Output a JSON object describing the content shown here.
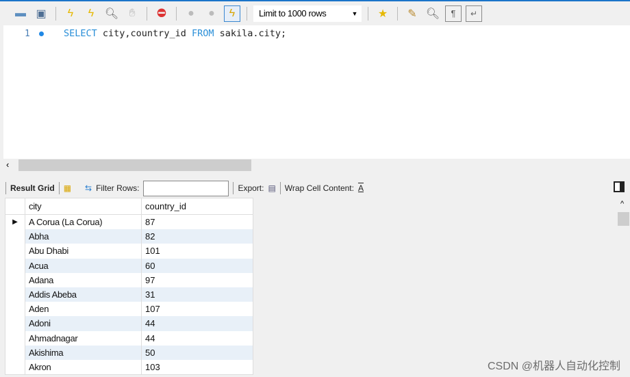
{
  "toolbar": {
    "limit_label": "Limit to 1000 rows"
  },
  "editor": {
    "line_number": "1",
    "keyword_select": "SELECT",
    "columns": " city,country_id ",
    "keyword_from": "FROM",
    "table": " sakila.city;"
  },
  "result_bar": {
    "result_grid": "Result Grid",
    "filter_rows": "Filter Rows:",
    "filter_value": "",
    "export": "Export:",
    "wrap": "Wrap Cell Content:"
  },
  "grid": {
    "columns": [
      "city",
      "country_id"
    ],
    "rows": [
      [
        "A Corua (La Corua)",
        "87"
      ],
      [
        "Abha",
        "82"
      ],
      [
        "Abu Dhabi",
        "101"
      ],
      [
        "Acua",
        "60"
      ],
      [
        "Adana",
        "97"
      ],
      [
        "Addis Abeba",
        "31"
      ],
      [
        "Aden",
        "107"
      ],
      [
        "Adoni",
        "44"
      ],
      [
        "Ahmadnagar",
        "44"
      ],
      [
        "Akishima",
        "50"
      ],
      [
        "Akron",
        "103"
      ]
    ]
  },
  "watermark": "CSDN @机器人自动化控制"
}
